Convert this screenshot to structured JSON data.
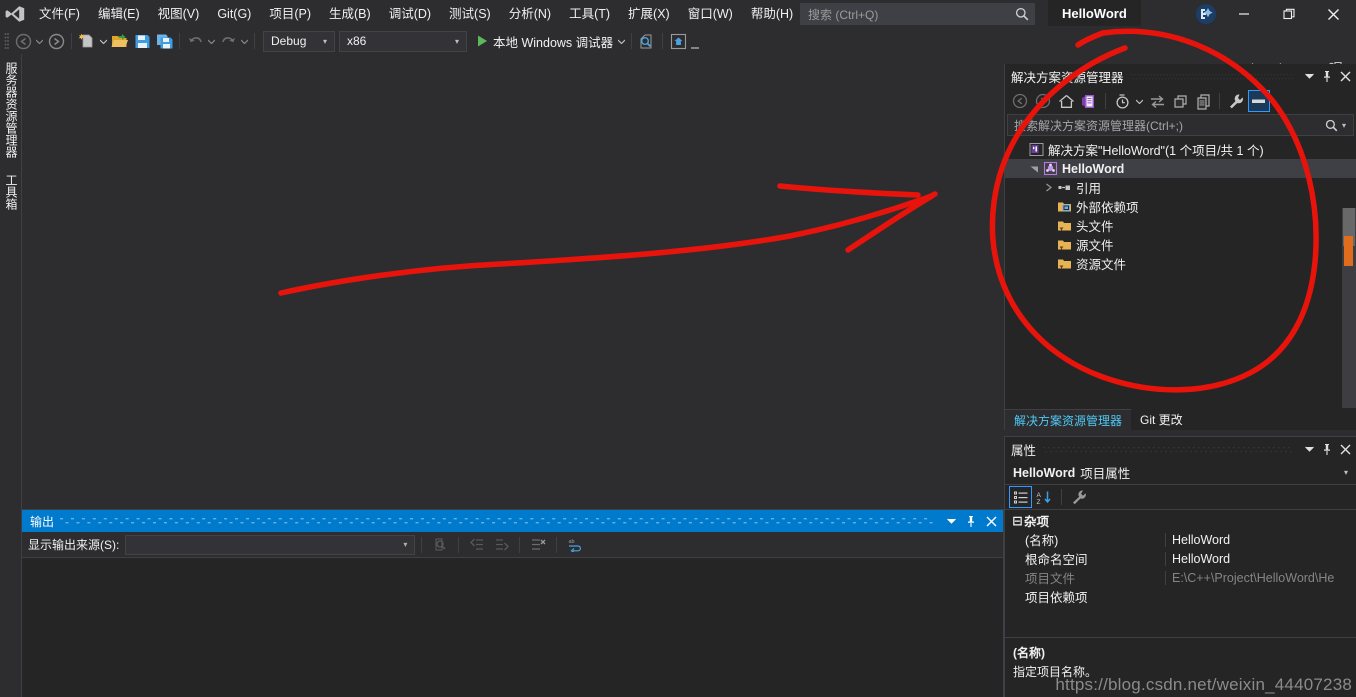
{
  "window": {
    "solution_name": "HelloWord",
    "minimize_label": "─",
    "maximize_label": "❐",
    "close_label": "✕"
  },
  "menu": {
    "items": [
      {
        "label": "文件(F)"
      },
      {
        "label": "编辑(E)"
      },
      {
        "label": "视图(V)"
      },
      {
        "label": "Git(G)"
      },
      {
        "label": "项目(P)"
      },
      {
        "label": "生成(B)"
      },
      {
        "label": "调试(D)"
      },
      {
        "label": "测试(S)"
      },
      {
        "label": "分析(N)"
      },
      {
        "label": "工具(T)"
      },
      {
        "label": "扩展(X)"
      },
      {
        "label": "窗口(W)"
      },
      {
        "label": "帮助(H)"
      }
    ]
  },
  "search": {
    "placeholder": "搜索 (Ctrl+Q)",
    "icon": "search-icon"
  },
  "toolbar": {
    "navigate_back": "navigate-back-icon",
    "navigate_forward": "navigate-forward-icon",
    "new_item": "new-item-icon",
    "open_file": "open-file-icon",
    "save": "save-icon",
    "save_all": "save-all-icon",
    "undo": "undo-icon",
    "redo": "redo-icon",
    "configuration": "Debug",
    "platform": "x86",
    "run_label": "本地 Windows 调试器",
    "run_icon": "play-icon",
    "find_icon": "find-in-files-icon",
    "preview_icon": "preview-icon",
    "overflow_icon": "overflow-icon"
  },
  "live_share": {
    "label": "Live Share",
    "icon": "share-icon",
    "feedback_icon": "send-feedback-icon"
  },
  "left_rail": {
    "tabs": [
      {
        "label": "服务器资源管理器"
      },
      {
        "label": "工具箱"
      }
    ]
  },
  "solution_explorer": {
    "title": "解决方案资源管理器",
    "header_buttons": [
      {
        "name": "dropdown-icon",
        "glyph": "▾"
      },
      {
        "name": "pin-icon",
        "glyph": "⍑"
      },
      {
        "name": "close-icon",
        "glyph": "✕"
      }
    ],
    "toolbar": [
      {
        "name": "back-icon"
      },
      {
        "name": "forward-icon"
      },
      {
        "name": "home-icon"
      },
      {
        "name": "switch-views-icon"
      },
      {
        "name": "pending-changes-icon"
      },
      {
        "name": "sync-with-active-document-icon"
      },
      {
        "name": "refresh-icon"
      },
      {
        "name": "show-all-files-icon"
      },
      {
        "name": "collapse-all-icon"
      },
      {
        "name": "properties-icon"
      },
      {
        "name": "preview-selected-items-icon"
      }
    ],
    "search_placeholder": "搜索解决方案资源管理器(Ctrl+;)",
    "tree": [
      {
        "label": "解决方案\"HelloWord\"(1 个项目/共 1 个)",
        "indent": 0,
        "icon": "solution-icon",
        "twisty": "none",
        "bold": false,
        "selected": false
      },
      {
        "label": "HelloWord",
        "indent": 1,
        "icon": "cpp-project-icon",
        "twisty": "expanded",
        "bold": true,
        "selected": true
      },
      {
        "label": "引用",
        "indent": 2,
        "icon": "references-icon",
        "twisty": "collapsed",
        "bold": false,
        "selected": false
      },
      {
        "label": "外部依赖项",
        "indent": 2,
        "icon": "external-dependencies-icon",
        "twisty": "none",
        "bold": false,
        "selected": false
      },
      {
        "label": "头文件",
        "indent": 2,
        "icon": "filter-folder-icon",
        "twisty": "none",
        "bold": false,
        "selected": false
      },
      {
        "label": "源文件",
        "indent": 2,
        "icon": "filter-folder-icon",
        "twisty": "none",
        "bold": false,
        "selected": false
      },
      {
        "label": "资源文件",
        "indent": 2,
        "icon": "filter-folder-icon",
        "twisty": "none",
        "bold": false,
        "selected": false
      }
    ],
    "tabs": [
      {
        "label": "解决方案资源管理器",
        "active": true
      },
      {
        "label": "Git 更改",
        "active": false
      }
    ]
  },
  "properties": {
    "title": "属性",
    "header_buttons": [
      {
        "name": "dropdown-icon",
        "glyph": "▾"
      },
      {
        "name": "pin-icon",
        "glyph": "⍑"
      },
      {
        "name": "close-icon",
        "glyph": "✕"
      }
    ],
    "object_name": "HelloWord",
    "object_suffix": "项目属性",
    "object_arrow": "▾",
    "toolbar": [
      {
        "name": "categorized-icon",
        "active": true
      },
      {
        "name": "alphabetical-icon",
        "active": false
      },
      {
        "name": "property-pages-icon",
        "active": false
      }
    ],
    "category": "杂项",
    "category_expander": "⊟",
    "rows": [
      {
        "key": "(名称)",
        "value": "HelloWord",
        "dim": false
      },
      {
        "key": "根命名空间",
        "value": "HelloWord",
        "dim": false
      },
      {
        "key": "项目文件",
        "value": "E:\\C++\\Project\\HelloWord\\He",
        "dim": true
      },
      {
        "key": "项目依赖项",
        "value": "",
        "dim": false
      }
    ],
    "description_title": "(名称)",
    "description_text": "指定项目名称。"
  },
  "output": {
    "title": "输出",
    "header_buttons": [
      {
        "name": "dropdown-icon",
        "glyph": "▾"
      },
      {
        "name": "pin-icon",
        "glyph": "⍑"
      },
      {
        "name": "close-icon",
        "glyph": "✕"
      }
    ],
    "source_label": "显示输出来源(S):",
    "source_value": "",
    "source_arrow": "▾",
    "buttons": [
      {
        "name": "find-message-icon"
      },
      {
        "name": "go-to-previous-message-icon"
      },
      {
        "name": "go-to-next-message-icon"
      },
      {
        "name": "clear-all-icon"
      },
      {
        "name": "toggle-word-wrap-icon"
      }
    ]
  },
  "watermark": "https://blog.csdn.net/weixin_44407238",
  "colors": {
    "accent": "#007acc",
    "chrome": "#2d2d30",
    "panel": "#252526",
    "annotation": "#e8140b",
    "link": "#4ec9f5"
  }
}
